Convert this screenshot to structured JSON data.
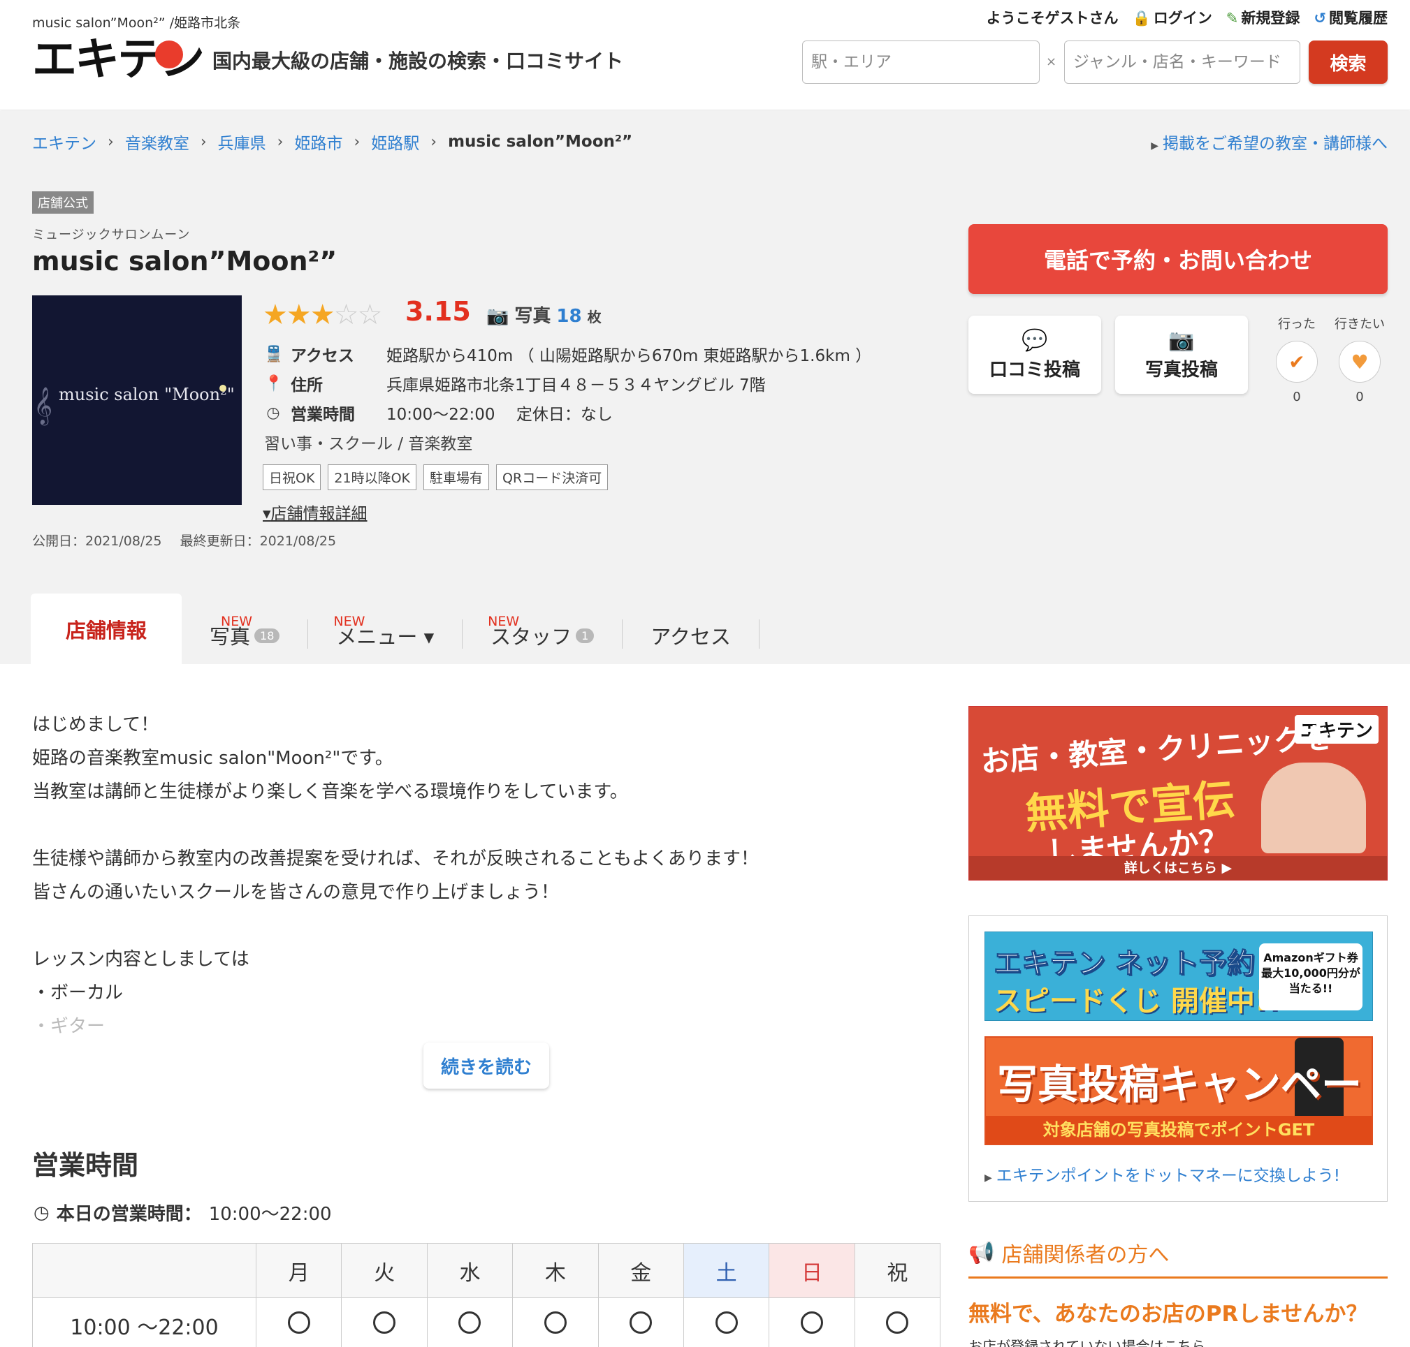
{
  "header": {
    "small_title": "music salon”Moon²” /姫路市北条",
    "logo": "エキテン",
    "tagline": "国内最大級の店舗・施設の検索・口コミサイト",
    "welcome": "ようこそゲストさん",
    "login": "ログイン",
    "register": "新規登録",
    "history": "閲覧履歴",
    "search_station_placeholder": "駅・エリア",
    "search_keyword_placeholder": "ジャンル・店名・キーワード",
    "search_separator": "×",
    "search_button": "検索"
  },
  "breadcrumb": {
    "items": [
      "エキテン",
      "音楽教室",
      "兵庫県",
      "姫路市",
      "姫路駅"
    ],
    "current": "music salon”Moon²”",
    "sep": "›",
    "promo_link": "掲載をご希望の教室・講師様へ"
  },
  "shop": {
    "badge": "店舗公式",
    "kana": "ミュージックサロンムーン",
    "name": "music salon”Moon²”",
    "image_text": "music salon \"Moon²\"",
    "rating": "3.15",
    "rating_value": 3.15,
    "stars_filled": 3,
    "stars_total": 5,
    "photo_label": "写真",
    "photo_count": "18",
    "photo_unit": "枚",
    "access_label": "アクセス",
    "access_value": "姫路駅から410m （ 山陽姫路駅から670m 東姫路駅から1.6km ）",
    "address_label": "住所",
    "address_value": "兵庫県姫路市北条1丁目４８－５３４ヤングビル 7階",
    "hours_label": "営業時間",
    "hours_value": "10:00〜22:00　 定休日：なし",
    "category": "習い事・スクール /  音楽教室",
    "tags": [
      "日祝OK",
      "21時以降OK",
      "駐車場有",
      "QRコード決済可"
    ],
    "detail_link": "店舗情報詳細",
    "published": "公開日：2021/08/25",
    "updated": "最終更新日：2021/08/25"
  },
  "actions": {
    "call": "電話で予約・お問い合わせ",
    "review": "口コミ投稿",
    "photo": "写真投稿",
    "went_label": "行った",
    "went_count": "0",
    "want_label": "行きたい",
    "want_count": "0"
  },
  "tabs": [
    {
      "label": "店舗情報",
      "new": "",
      "count": ""
    },
    {
      "label": "写真",
      "new": "NEW",
      "count": "18"
    },
    {
      "label": "メニュー ▾",
      "new": "NEW",
      "count": ""
    },
    {
      "label": "スタッフ",
      "new": "NEW",
      "count": "1"
    },
    {
      "label": "アクセス",
      "new": "",
      "count": ""
    }
  ],
  "intro": {
    "lines": [
      "はじめまして！",
      "姫路の音楽教室music salon\"Moon²\"です。",
      "当教室は講師と生徒様がより楽しく音楽を学べる環境作りをしています。",
      "",
      "生徒様や講師から教室内の改善提案を受ければ、それが反映されることもよくあります！",
      "皆さんの通いたいスクールを皆さんの意見で作り上げましょう！",
      "",
      "レッスン内容としましては",
      "・ボーカル",
      "・ギター"
    ],
    "read_more": "続きを読む"
  },
  "hours": {
    "title": "営業時間",
    "today_label": "本日の営業時間：",
    "today_value": "10:00〜22:00",
    "days": [
      "月",
      "火",
      "水",
      "木",
      "金",
      "土",
      "日",
      "祝"
    ],
    "row_time": "10:00 〜22:00"
  },
  "sidebar": {
    "ad1_line1": "お店・教室・クリニックを",
    "ad1_line2": "無料で宣伝",
    "ad1_line3": "しませんか？",
    "ad1_logo": "エキテン",
    "ad1_foot": "詳しくはこちら ▶",
    "ad2_line1": "エキテン ネット予約",
    "ad2_line2": "スピードくじ 開催中!!",
    "ad2_badge": "Amazonギフト券 最大10,000円分が 当たる!!",
    "ad3_line1": "写真投稿キャンペーン",
    "ad3_foot": "対象店舗の写真投稿でポイントGET",
    "point_link": "エキテンポイントをドットマネーに交換しよう!",
    "owners_title": "店舗関係者の方へ",
    "owners_pr": "無料で、あなたのお店のPRしませんか？",
    "owners_note": "お店が登録されていない場合はこちら"
  },
  "colors": {
    "brand_red": "#e8473c",
    "link_blue": "#2f7fd0",
    "star": "#f5a623",
    "owner_orange": "#ea7a1e"
  }
}
